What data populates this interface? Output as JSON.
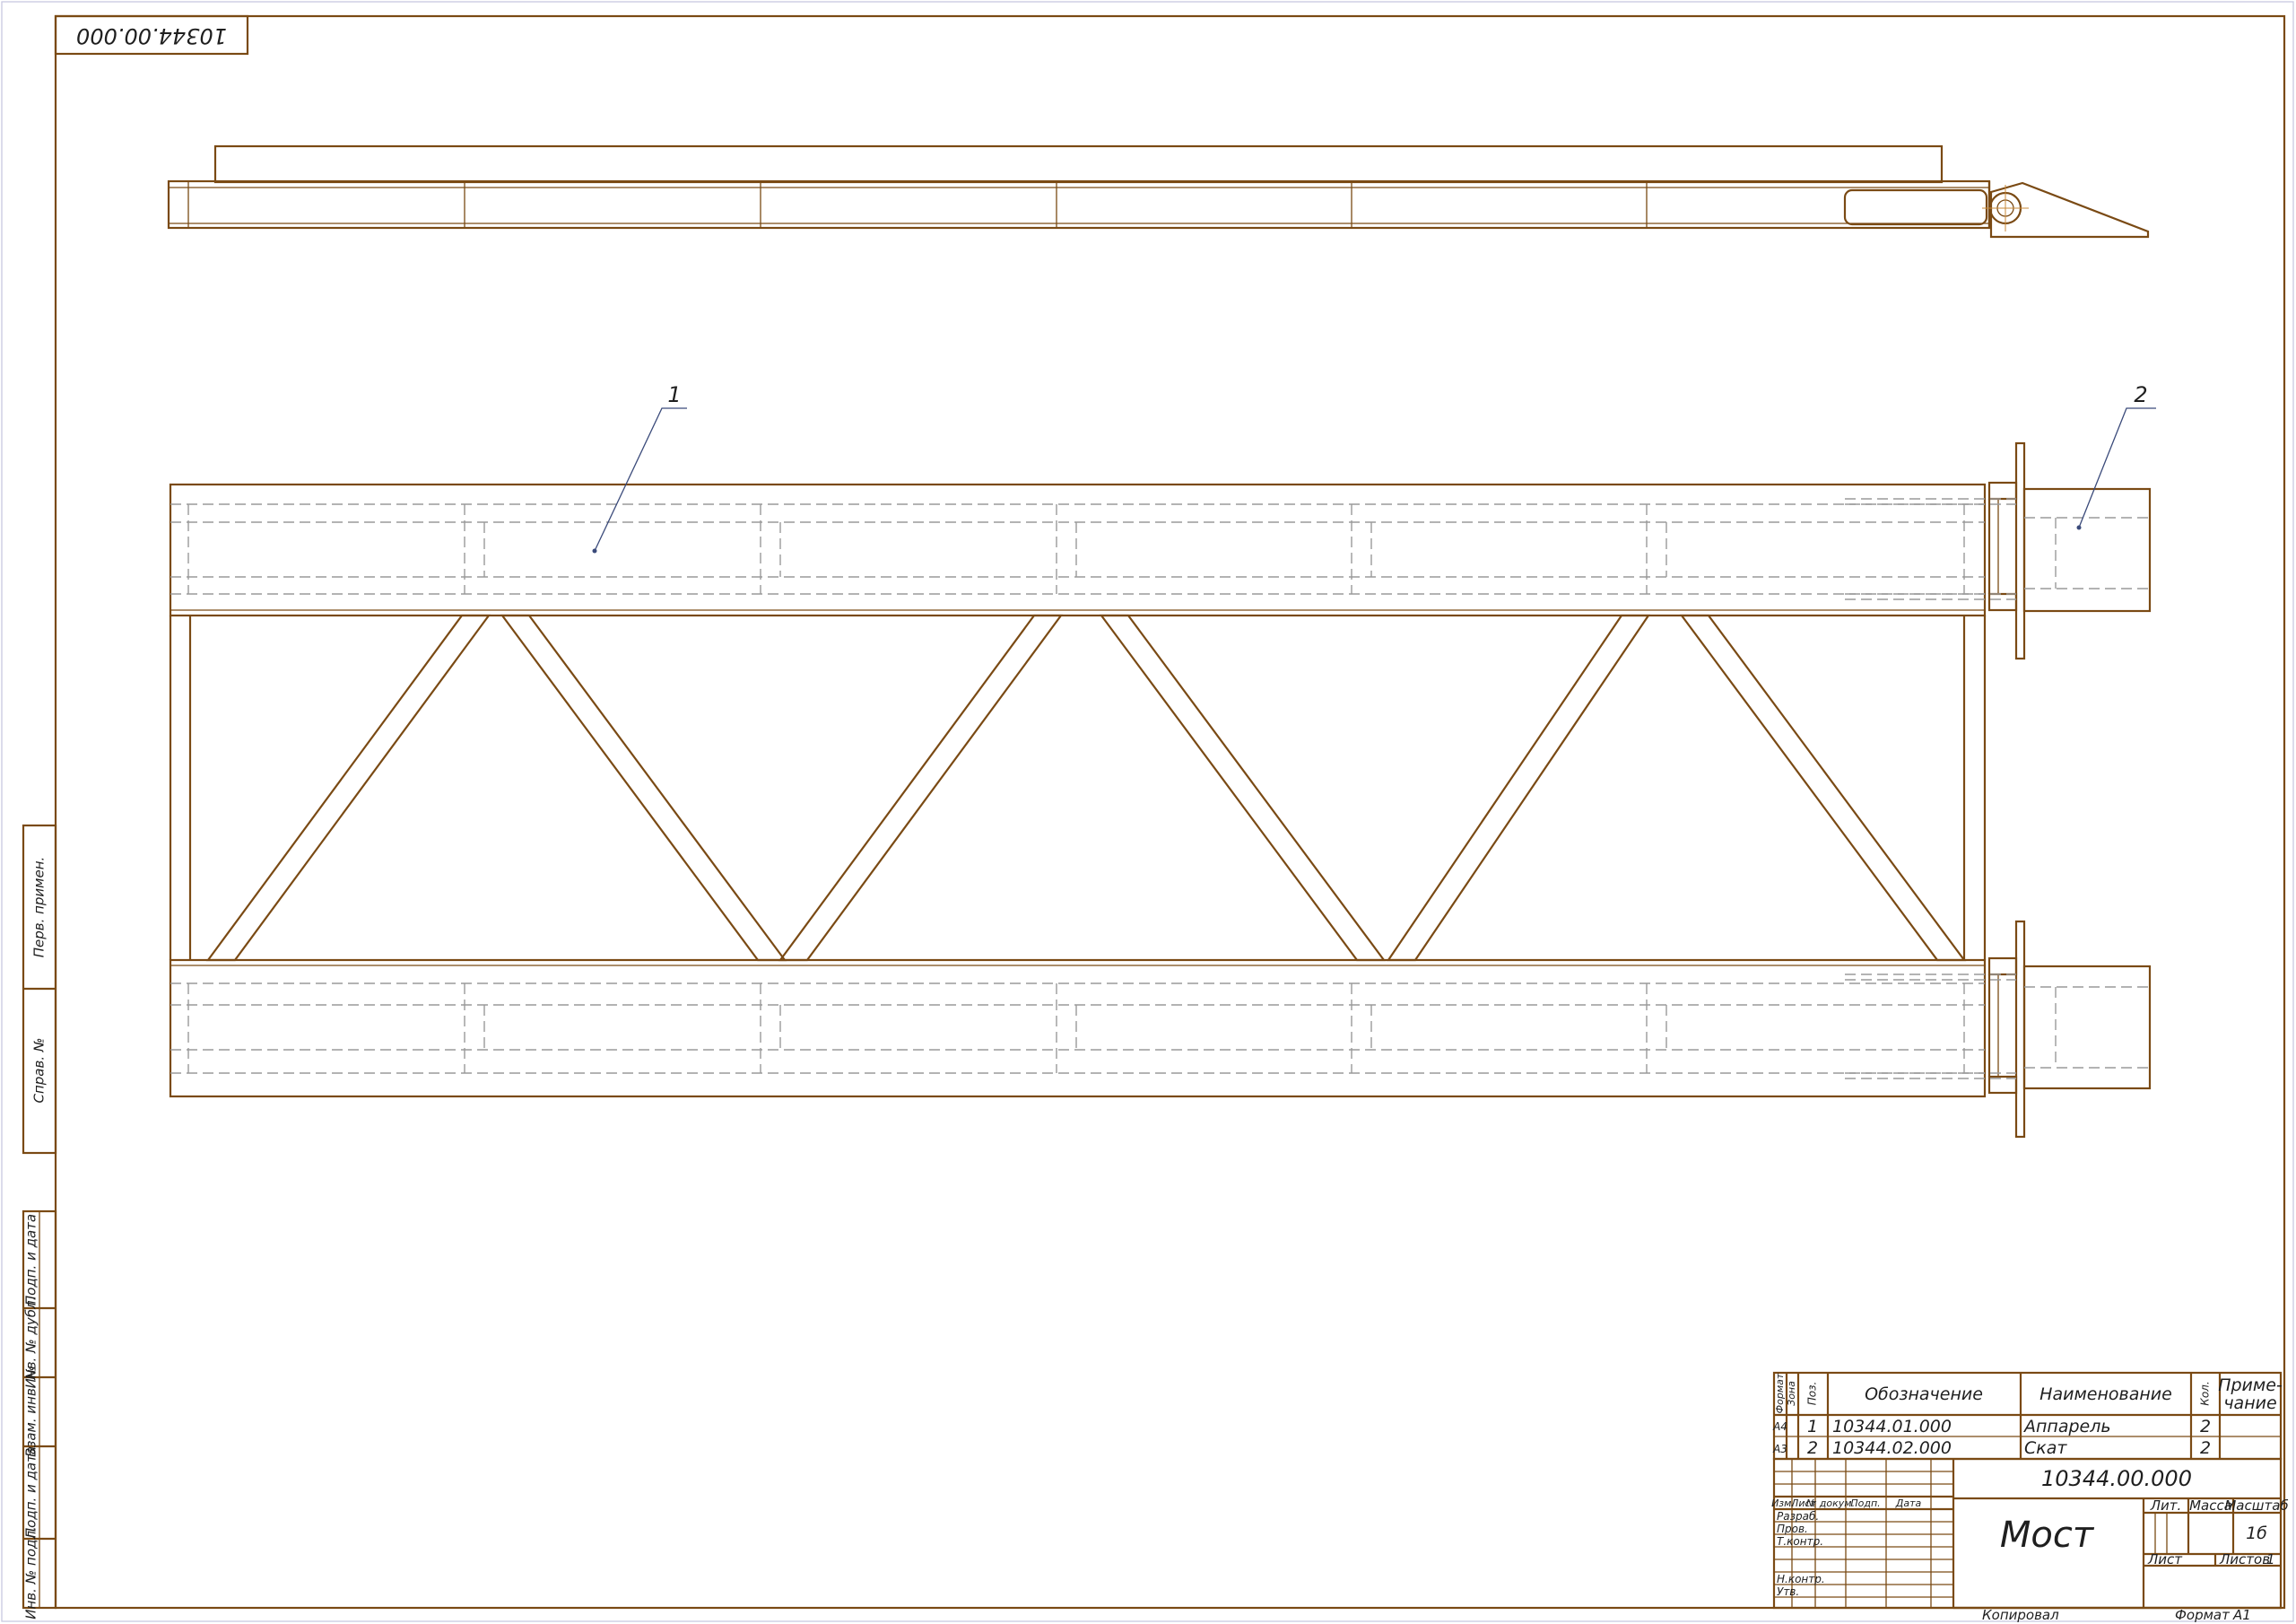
{
  "stamp_top": "10344.00.000",
  "positions": {
    "pos1": "1",
    "pos2": "2"
  },
  "spec": {
    "headers": {
      "format": "Формат",
      "zone": "Зона",
      "pos": "Поз.",
      "designation": "Обозначение",
      "name": "Наименование",
      "qty": "Кол.",
      "note_1": "Приме-",
      "note_2": "чание"
    },
    "rows": [
      {
        "format": "А4",
        "pos": "1",
        "designation": "10344.01.000",
        "name": "Аппарель",
        "qty": "2"
      },
      {
        "format": "А3",
        "pos": "2",
        "designation": "10344.02.000",
        "name": "Скат",
        "qty": "2"
      }
    ]
  },
  "title_block": {
    "designation": "10344.00.000",
    "title": "Мост",
    "lit": "Лит.",
    "mass": "Масса",
    "scale": "Масштаб",
    "scale_value": "1б",
    "sheet": "Лист",
    "sheets": "Листов",
    "sheets_value": "1",
    "header_labels": [
      "Изм.",
      "Лист",
      "№ докум.",
      "Подп.",
      "Дата"
    ],
    "roles": [
      "Разраб.",
      "Пров.",
      "Т.контр.",
      "Н.контр.",
      "Утв."
    ],
    "copied": "Копировал",
    "format": "Формат",
    "format_value": "А1"
  },
  "side_stamps": [
    "Перв. примен.",
    "Справ. №",
    "Подп. и дата",
    "Инв. № дубл.",
    "Взам. инв. №",
    "Подп. и дата",
    "Инв. № подл."
  ],
  "colors": {
    "line": "#7a4a14",
    "hidden": "#9a9a9a",
    "leader": "#3a4a7a",
    "frame": "#7a4a14"
  }
}
